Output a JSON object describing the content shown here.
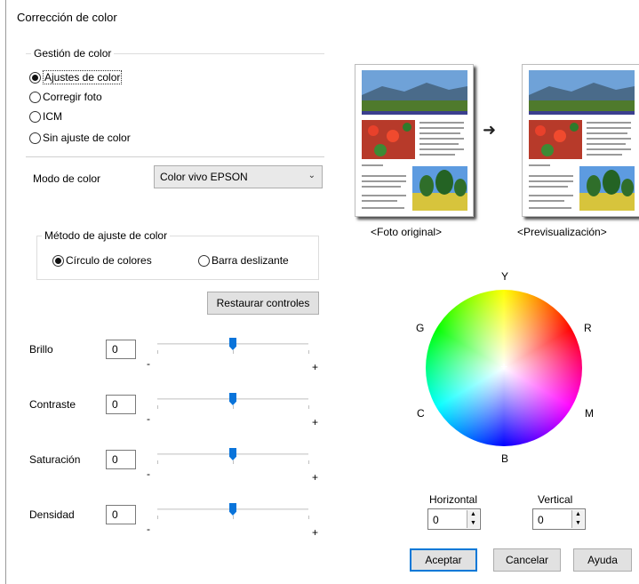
{
  "window": {
    "title": "Corrección de color"
  },
  "color_management": {
    "group_label": "Gestión de color",
    "options": [
      "Ajustes de color",
      "Corregir foto",
      "ICM",
      "Sin ajuste de color"
    ],
    "selected": 0
  },
  "color_mode": {
    "label": "Modo de color",
    "value": "Color vivo EPSON"
  },
  "adjust_method": {
    "group_label": "Método de ajuste de color",
    "options": [
      "Círculo de colores",
      "Barra deslizante"
    ],
    "selected": 0
  },
  "reset_button": "Restaurar controles",
  "sliders": [
    {
      "label": "Brillo",
      "value": "0",
      "level": 0.5
    },
    {
      "label": "Contraste",
      "value": "0",
      "level": 0.5
    },
    {
      "label": "Saturación",
      "value": "0",
      "level": 0.5
    },
    {
      "label": "Densidad",
      "value": "0",
      "level": 0.5
    }
  ],
  "slider_min": "-",
  "slider_max": "+",
  "preview": {
    "original_label": "<Foto original>",
    "preview_label": "<Previsualización>",
    "arrow": "➜"
  },
  "wheel": {
    "labels": {
      "Y": "Y",
      "R": "R",
      "M": "M",
      "B": "B",
      "C": "C",
      "G": "G"
    }
  },
  "horizontal": {
    "label": "Horizontal",
    "value": "0"
  },
  "vertical": {
    "label": "Vertical",
    "value": "0"
  },
  "footer": {
    "ok": "Aceptar",
    "cancel": "Cancelar",
    "help": "Ayuda"
  },
  "colors": {
    "accent": "#0078d7",
    "thumb": "#0a74da"
  }
}
